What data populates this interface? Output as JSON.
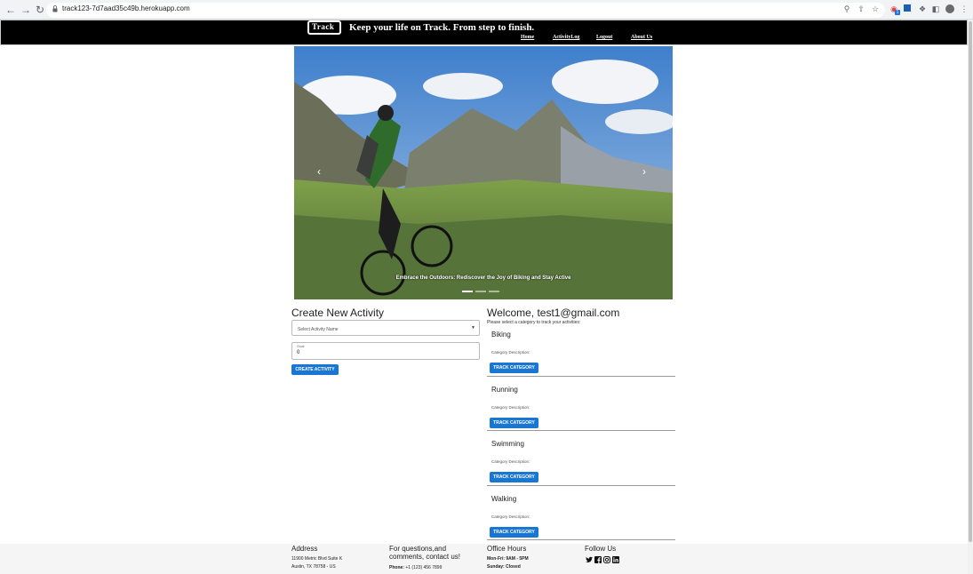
{
  "browser": {
    "url": "track123-7d7aad35c49b.herokuapp.com",
    "extension_badge": "1"
  },
  "header": {
    "logo_text": "Track",
    "tagline": "Keep your life on Track. From step to finish.",
    "nav": [
      "Home",
      "ActivityLog",
      "Logout",
      "About Us"
    ]
  },
  "carousel": {
    "caption": "Embrace the Outdoors: Rediscover the Joy of Biking and Stay Active",
    "slide_count": 3,
    "active_slide": 1
  },
  "create": {
    "title": "Create New Activity",
    "select_placeholder": "Select Activity Name",
    "goal_label": "Goal",
    "goal_value": "0",
    "button": "CREATE ACTIVITY"
  },
  "welcome": {
    "title": "Welcome, test1@gmail.com",
    "subtitle": "Please select a category to track your activities:",
    "categories": [
      {
        "name": "Biking",
        "description": "Category Description:",
        "button": "TRACK CATEGORY"
      },
      {
        "name": "Running",
        "description": "Category Description:",
        "button": "TRACK CATEGORY"
      },
      {
        "name": "Swimming",
        "description": "Category Description:",
        "button": "TRACK CATEGORY"
      },
      {
        "name": "Walking",
        "description": "Category Description:",
        "button": "TRACK CATEGORY"
      }
    ]
  },
  "footer": {
    "address_title": "Address",
    "address_line1": "11900 Metric Blvd Suite K",
    "address_line2": "Austin, TX 78758 - US",
    "contact_title": "For questions,and comments, contact us!",
    "phone_label": "Phone:",
    "phone_value": "+1 (123) 456 7899",
    "hours_title": "Office Hours",
    "hours_weekday": "Mon-Fri: 9AM - 5PM",
    "hours_sunday": "Sunday: Closed",
    "follow_title": "Follow Us",
    "social": [
      "twitter-icon",
      "facebook-icon",
      "instagram-icon",
      "linkedin-icon"
    ]
  },
  "colors": {
    "header_bg": "#000000",
    "button": "#1976d2",
    "footer_bg": "#f5f5f5"
  }
}
